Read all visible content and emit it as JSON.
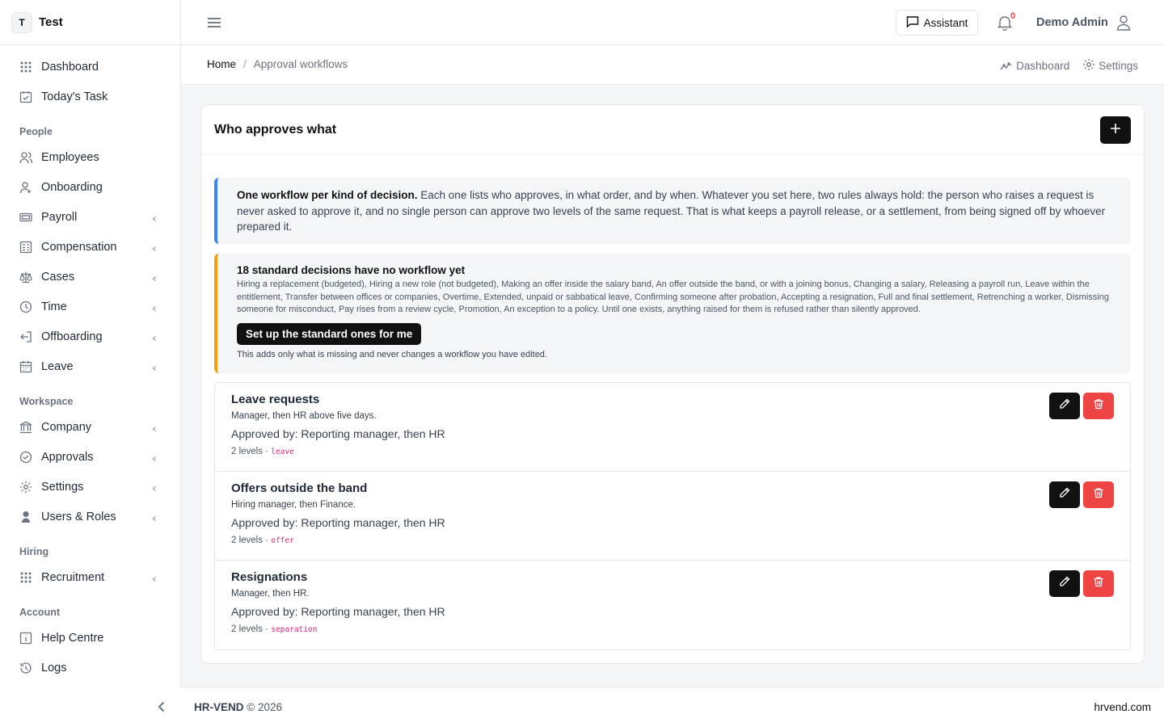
{
  "brand": {
    "badge": "T",
    "name": "Test"
  },
  "sidebar": {
    "top_items": [
      {
        "label": "Dashboard",
        "icon": "grid-icon"
      },
      {
        "label": "Today's Task",
        "icon": "calendar-check-icon"
      }
    ],
    "sections": [
      {
        "title": "People",
        "items": [
          {
            "label": "Employees",
            "icon": "users-icon",
            "chevron": false
          },
          {
            "label": "Onboarding",
            "icon": "user-plus-icon",
            "chevron": false
          },
          {
            "label": "Payroll",
            "icon": "banknote-icon",
            "chevron": true
          },
          {
            "label": "Compensation",
            "icon": "calculator-icon",
            "chevron": true
          },
          {
            "label": "Cases",
            "icon": "scale-icon",
            "chevron": true
          },
          {
            "label": "Time",
            "icon": "clock-icon",
            "chevron": true
          },
          {
            "label": "Offboarding",
            "icon": "log-out-icon",
            "chevron": true
          },
          {
            "label": "Leave",
            "icon": "calendar-icon",
            "chevron": true
          }
        ]
      },
      {
        "title": "Workspace",
        "items": [
          {
            "label": "Company",
            "icon": "building-icon",
            "chevron": true
          },
          {
            "label": "Approvals",
            "icon": "check-circle-icon",
            "chevron": true
          },
          {
            "label": "Settings",
            "icon": "gear-icon",
            "chevron": true
          },
          {
            "label": "Users & Roles",
            "icon": "user-shield-icon",
            "chevron": true
          }
        ]
      },
      {
        "title": "Hiring",
        "items": [
          {
            "label": "Recruitment",
            "icon": "grid-icon",
            "chevron": true
          }
        ]
      },
      {
        "title": "Account",
        "items": [
          {
            "label": "Help Centre",
            "icon": "info-icon",
            "chevron": false
          },
          {
            "label": "Logs",
            "icon": "history-icon",
            "chevron": false
          }
        ]
      }
    ]
  },
  "topbar": {
    "assistant_label": "Assistant",
    "notification_count": "0",
    "user_name": "Demo Admin"
  },
  "breadcrumb": {
    "home": "Home",
    "separator": "/",
    "current": "Approval workflows"
  },
  "sub_links": {
    "dashboard": "Dashboard",
    "settings": "Settings"
  },
  "card": {
    "title": "Who approves what",
    "info_lead": "One workflow per kind of decision.",
    "info_text": " Each one lists who approves, in what order, and by when. Whatever you set here, two rules always hold: the person who raises a request is never asked to approve it, and no single person can approve two levels of the same request. That is what keeps a payroll release, or a settlement, from being signed off by whoever prepared it.",
    "warning_title": "18 standard decisions have no workflow yet",
    "warning_text": "Hiring a replacement (budgeted), Hiring a new role (not budgeted), Making an offer inside the salary band, An offer outside the band, or with a joining bonus, Changing a salary, Releasing a payroll run, Leave within the entitlement, Transfer between offices or companies, Overtime, Extended, unpaid or sabbatical leave, Confirming someone after probation, Accepting a resignation, Full and final settlement, Retrenching a worker, Dismissing someone for misconduct, Pay rises from a review cycle, Promotion, An exception to a policy. Until one exists, anything raised for them is refused rather than silently approved.",
    "setup_button": "Set up the standard ones for me",
    "setup_note": "This adds only what is missing and never changes a workflow you have edited."
  },
  "workflows": [
    {
      "title": "Leave requests",
      "desc": "Manager, then HR above five days.",
      "approved_by": "Approved by: Reporting manager, then HR",
      "levels": "2 levels · ",
      "code": "leave"
    },
    {
      "title": "Offers outside the band",
      "desc": "Hiring manager, then Finance.",
      "approved_by": "Approved by: Reporting manager, then HR",
      "levels": "2 levels · ",
      "code": "offer"
    },
    {
      "title": "Resignations",
      "desc": "Manager, then HR.",
      "approved_by": "Approved by: Reporting manager, then HR",
      "levels": "2 levels · ",
      "code": "separation"
    }
  ],
  "footer": {
    "brand": "HR-VEND",
    "copyright": "© 2026",
    "site": "hrvend.com"
  }
}
